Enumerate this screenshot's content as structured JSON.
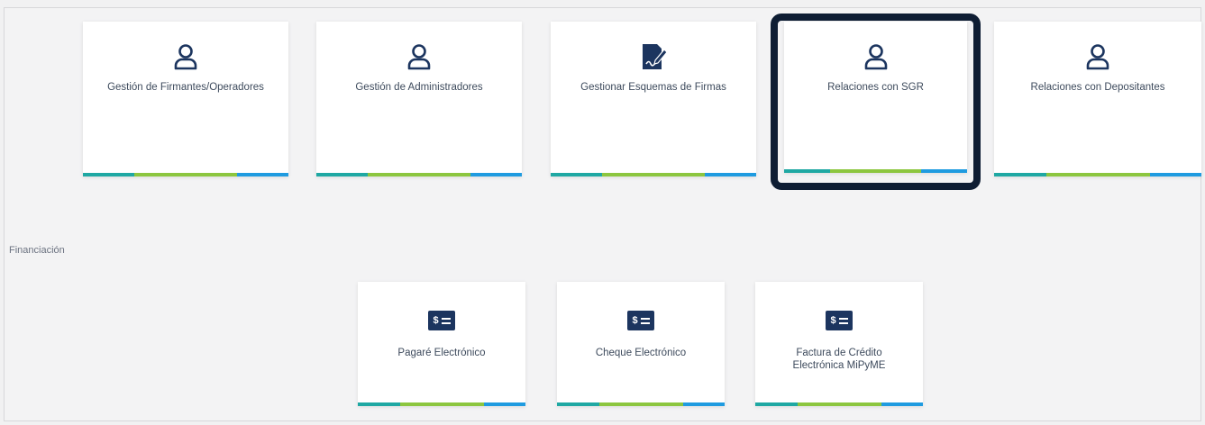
{
  "colors": {
    "icon_navy": "#1c355f",
    "highlight": "#0e1d33",
    "bar_green": "#8cc63f",
    "bar_teal": "#1fa8a3",
    "bar_blue": "#1f9be0"
  },
  "top_cards": [
    {
      "label": "Gestión de Firmantes/Operadores",
      "icon": "user-icon"
    },
    {
      "label": "Gestión de Administradores",
      "icon": "user-icon"
    },
    {
      "label": "Gestionar Esquemas de Firmas",
      "icon": "signature-document-icon"
    },
    {
      "label": "Relaciones con SGR",
      "icon": "user-icon"
    },
    {
      "label": "Relaciones con Depositantes",
      "icon": "user-icon"
    }
  ],
  "section": {
    "title": "Financiación"
  },
  "financing_cards": [
    {
      "label": "Pagaré Electrónico",
      "icon": "money-icon",
      "icon_text": "$"
    },
    {
      "label": "Cheque Electrónico",
      "icon": "money-icon",
      "icon_text": "$"
    },
    {
      "label": "Factura de Crédito Electrónica MiPyME",
      "icon": "money-icon",
      "icon_text": "$"
    }
  ]
}
